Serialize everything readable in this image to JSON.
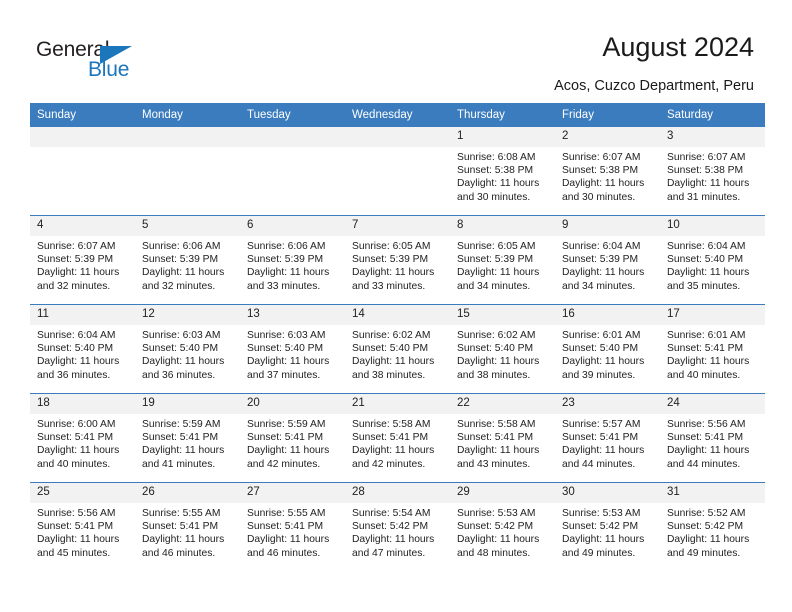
{
  "brand": {
    "name_top": "General",
    "name_bottom": "Blue",
    "accent_color": "#1b76bc",
    "triangle_icon": "logo-triangle-icon"
  },
  "header": {
    "title": "August 2024",
    "subtitle": "Acos, Cuzco Department, Peru"
  },
  "calendar": {
    "header_bg": "#3a7cbe",
    "daynum_bg": "#f2f2f2",
    "weekdays": [
      "Sunday",
      "Monday",
      "Tuesday",
      "Wednesday",
      "Thursday",
      "Friday",
      "Saturday"
    ],
    "weeks": [
      [
        {
          "day": "",
          "empty": true
        },
        {
          "day": "",
          "empty": true
        },
        {
          "day": "",
          "empty": true
        },
        {
          "day": "",
          "empty": true
        },
        {
          "day": "1",
          "sunrise": "Sunrise: 6:08 AM",
          "sunset": "Sunset: 5:38 PM",
          "daylight1": "Daylight: 11 hours",
          "daylight2": "and 30 minutes."
        },
        {
          "day": "2",
          "sunrise": "Sunrise: 6:07 AM",
          "sunset": "Sunset: 5:38 PM",
          "daylight1": "Daylight: 11 hours",
          "daylight2": "and 30 minutes."
        },
        {
          "day": "3",
          "sunrise": "Sunrise: 6:07 AM",
          "sunset": "Sunset: 5:38 PM",
          "daylight1": "Daylight: 11 hours",
          "daylight2": "and 31 minutes."
        }
      ],
      [
        {
          "day": "4",
          "sunrise": "Sunrise: 6:07 AM",
          "sunset": "Sunset: 5:39 PM",
          "daylight1": "Daylight: 11 hours",
          "daylight2": "and 32 minutes."
        },
        {
          "day": "5",
          "sunrise": "Sunrise: 6:06 AM",
          "sunset": "Sunset: 5:39 PM",
          "daylight1": "Daylight: 11 hours",
          "daylight2": "and 32 minutes."
        },
        {
          "day": "6",
          "sunrise": "Sunrise: 6:06 AM",
          "sunset": "Sunset: 5:39 PM",
          "daylight1": "Daylight: 11 hours",
          "daylight2": "and 33 minutes."
        },
        {
          "day": "7",
          "sunrise": "Sunrise: 6:05 AM",
          "sunset": "Sunset: 5:39 PM",
          "daylight1": "Daylight: 11 hours",
          "daylight2": "and 33 minutes."
        },
        {
          "day": "8",
          "sunrise": "Sunrise: 6:05 AM",
          "sunset": "Sunset: 5:39 PM",
          "daylight1": "Daylight: 11 hours",
          "daylight2": "and 34 minutes."
        },
        {
          "day": "9",
          "sunrise": "Sunrise: 6:04 AM",
          "sunset": "Sunset: 5:39 PM",
          "daylight1": "Daylight: 11 hours",
          "daylight2": "and 34 minutes."
        },
        {
          "day": "10",
          "sunrise": "Sunrise: 6:04 AM",
          "sunset": "Sunset: 5:40 PM",
          "daylight1": "Daylight: 11 hours",
          "daylight2": "and 35 minutes."
        }
      ],
      [
        {
          "day": "11",
          "sunrise": "Sunrise: 6:04 AM",
          "sunset": "Sunset: 5:40 PM",
          "daylight1": "Daylight: 11 hours",
          "daylight2": "and 36 minutes."
        },
        {
          "day": "12",
          "sunrise": "Sunrise: 6:03 AM",
          "sunset": "Sunset: 5:40 PM",
          "daylight1": "Daylight: 11 hours",
          "daylight2": "and 36 minutes."
        },
        {
          "day": "13",
          "sunrise": "Sunrise: 6:03 AM",
          "sunset": "Sunset: 5:40 PM",
          "daylight1": "Daylight: 11 hours",
          "daylight2": "and 37 minutes."
        },
        {
          "day": "14",
          "sunrise": "Sunrise: 6:02 AM",
          "sunset": "Sunset: 5:40 PM",
          "daylight1": "Daylight: 11 hours",
          "daylight2": "and 38 minutes."
        },
        {
          "day": "15",
          "sunrise": "Sunrise: 6:02 AM",
          "sunset": "Sunset: 5:40 PM",
          "daylight1": "Daylight: 11 hours",
          "daylight2": "and 38 minutes."
        },
        {
          "day": "16",
          "sunrise": "Sunrise: 6:01 AM",
          "sunset": "Sunset: 5:40 PM",
          "daylight1": "Daylight: 11 hours",
          "daylight2": "and 39 minutes."
        },
        {
          "day": "17",
          "sunrise": "Sunrise: 6:01 AM",
          "sunset": "Sunset: 5:41 PM",
          "daylight1": "Daylight: 11 hours",
          "daylight2": "and 40 minutes."
        }
      ],
      [
        {
          "day": "18",
          "sunrise": "Sunrise: 6:00 AM",
          "sunset": "Sunset: 5:41 PM",
          "daylight1": "Daylight: 11 hours",
          "daylight2": "and 40 minutes."
        },
        {
          "day": "19",
          "sunrise": "Sunrise: 5:59 AM",
          "sunset": "Sunset: 5:41 PM",
          "daylight1": "Daylight: 11 hours",
          "daylight2": "and 41 minutes."
        },
        {
          "day": "20",
          "sunrise": "Sunrise: 5:59 AM",
          "sunset": "Sunset: 5:41 PM",
          "daylight1": "Daylight: 11 hours",
          "daylight2": "and 42 minutes."
        },
        {
          "day": "21",
          "sunrise": "Sunrise: 5:58 AM",
          "sunset": "Sunset: 5:41 PM",
          "daylight1": "Daylight: 11 hours",
          "daylight2": "and 42 minutes."
        },
        {
          "day": "22",
          "sunrise": "Sunrise: 5:58 AM",
          "sunset": "Sunset: 5:41 PM",
          "daylight1": "Daylight: 11 hours",
          "daylight2": "and 43 minutes."
        },
        {
          "day": "23",
          "sunrise": "Sunrise: 5:57 AM",
          "sunset": "Sunset: 5:41 PM",
          "daylight1": "Daylight: 11 hours",
          "daylight2": "and 44 minutes."
        },
        {
          "day": "24",
          "sunrise": "Sunrise: 5:56 AM",
          "sunset": "Sunset: 5:41 PM",
          "daylight1": "Daylight: 11 hours",
          "daylight2": "and 44 minutes."
        }
      ],
      [
        {
          "day": "25",
          "sunrise": "Sunrise: 5:56 AM",
          "sunset": "Sunset: 5:41 PM",
          "daylight1": "Daylight: 11 hours",
          "daylight2": "and 45 minutes."
        },
        {
          "day": "26",
          "sunrise": "Sunrise: 5:55 AM",
          "sunset": "Sunset: 5:41 PM",
          "daylight1": "Daylight: 11 hours",
          "daylight2": "and 46 minutes."
        },
        {
          "day": "27",
          "sunrise": "Sunrise: 5:55 AM",
          "sunset": "Sunset: 5:41 PM",
          "daylight1": "Daylight: 11 hours",
          "daylight2": "and 46 minutes."
        },
        {
          "day": "28",
          "sunrise": "Sunrise: 5:54 AM",
          "sunset": "Sunset: 5:42 PM",
          "daylight1": "Daylight: 11 hours",
          "daylight2": "and 47 minutes."
        },
        {
          "day": "29",
          "sunrise": "Sunrise: 5:53 AM",
          "sunset": "Sunset: 5:42 PM",
          "daylight1": "Daylight: 11 hours",
          "daylight2": "and 48 minutes."
        },
        {
          "day": "30",
          "sunrise": "Sunrise: 5:53 AM",
          "sunset": "Sunset: 5:42 PM",
          "daylight1": "Daylight: 11 hours",
          "daylight2": "and 49 minutes."
        },
        {
          "day": "31",
          "sunrise": "Sunrise: 5:52 AM",
          "sunset": "Sunset: 5:42 PM",
          "daylight1": "Daylight: 11 hours",
          "daylight2": "and 49 minutes."
        }
      ]
    ]
  }
}
